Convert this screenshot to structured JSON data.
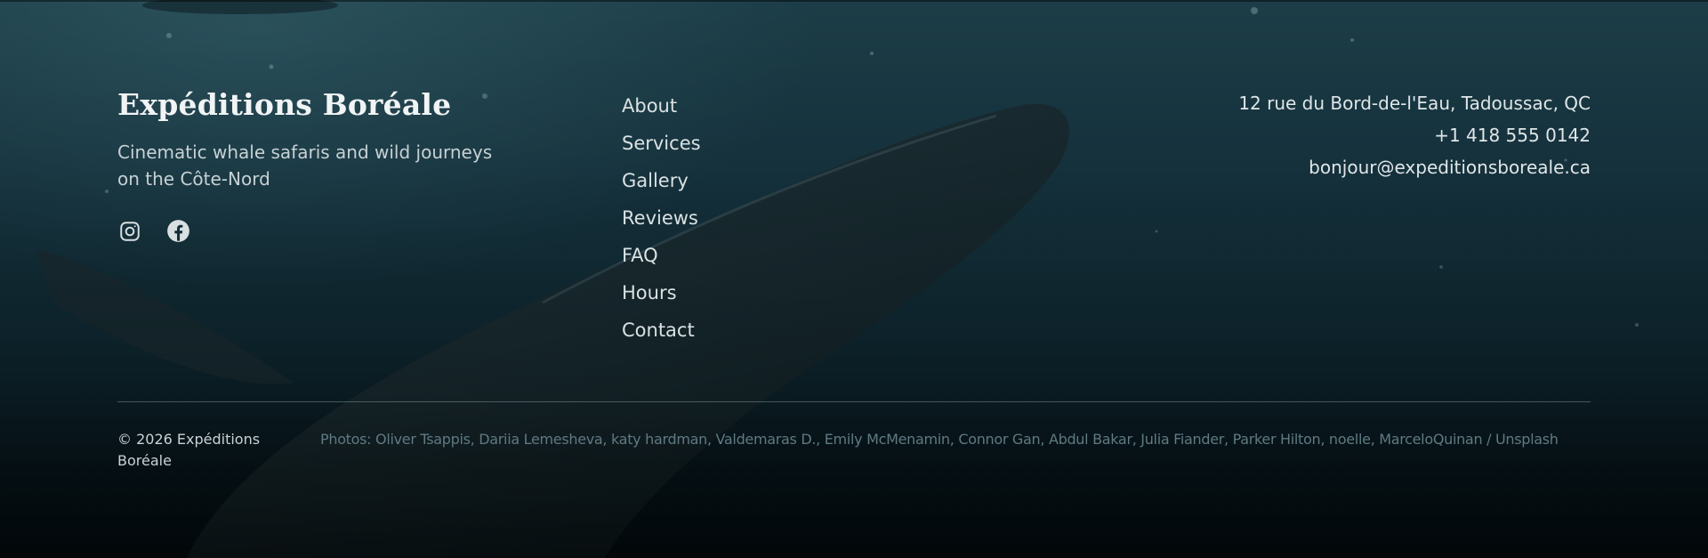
{
  "brand": {
    "name": "Expéditions Boréale",
    "tagline": "Cinematic whale safaris and wild journeys on the Côte-Nord"
  },
  "socials": [
    {
      "icon": "instagram-icon",
      "label": "Instagram"
    },
    {
      "icon": "facebook-icon",
      "label": "Facebook"
    }
  ],
  "nav": {
    "items": [
      "About",
      "Services",
      "Gallery",
      "Reviews",
      "FAQ",
      "Hours",
      "Contact"
    ]
  },
  "contact": {
    "address": "12 rue du Bord-de-l'Eau, Tadoussac, QC",
    "phone": "+1 418 555 0142",
    "email": "bonjour@expeditionsboreale.ca"
  },
  "bottom": {
    "copyright": "© 2026 Expéditions Boréale",
    "credits": "Photos: Oliver Tsappis, Dariia Lemesheva, katy hardman, Valdemaras D., Emily McMenamin, Connor Gan, Abdul Bakar, Julia Fiander, Parker Hilton, noelle, MarceloQuinan / Unsplash"
  },
  "colors": {
    "accent_text": "#dfe6e8",
    "muted_text": "#5f7a82",
    "background_top": "#1c3d47",
    "background_bottom": "#041015"
  }
}
